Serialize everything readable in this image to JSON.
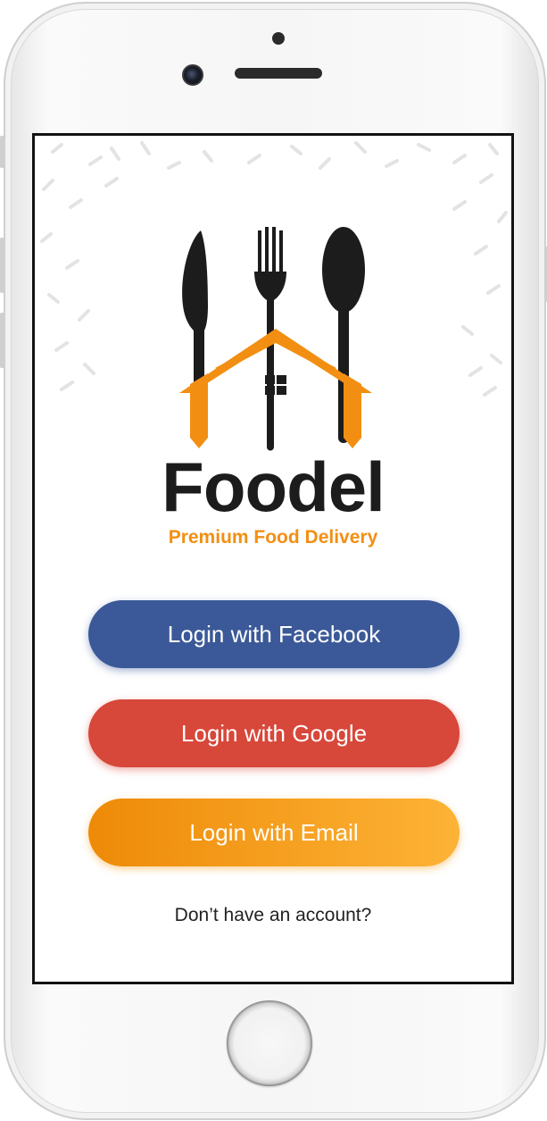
{
  "app": {
    "brand": "Foodel",
    "tagline": "Premium Food Delivery"
  },
  "login": {
    "facebook_label": "Login with Facebook",
    "google_label": "Login with Google",
    "email_label": "Login with Email",
    "signup_link": "Don’t have an account?"
  },
  "colors": {
    "brand_orange": "#f28f12",
    "facebook_blue": "#3b5998",
    "google_red": "#d7473a",
    "email_orange": "#fdb336",
    "logo_dark": "#1c1c1c"
  },
  "icons": [
    "knife-icon",
    "fork-icon",
    "spoon-icon",
    "house-roof-icon",
    "window-icon"
  ]
}
